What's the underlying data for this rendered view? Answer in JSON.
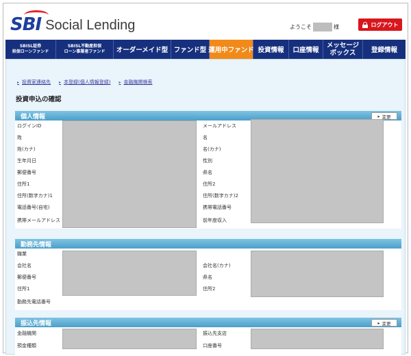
{
  "header": {
    "logo_sbi": "SBI",
    "logo_text": "Social Lending",
    "welcome_prefix": "ようこそ",
    "welcome_suffix": "様",
    "logout_label": "ログアウト"
  },
  "nav": {
    "items": [
      {
        "line1": "SBISL証券",
        "line2": "担保ローンファンド"
      },
      {
        "line1": "SBISL不動産担保",
        "line2": "ローン事業者ファンド"
      },
      {
        "label": "オーダーメイド型"
      },
      {
        "label": "ファンド型"
      },
      {
        "label": "運用中ファンド"
      },
      {
        "label": "投資情報"
      },
      {
        "label": "口座情報"
      },
      {
        "line1": "メッセージ",
        "line2": "ボックス"
      },
      {
        "label": "登録情報"
      }
    ]
  },
  "breadcrumb": [
    "投資家連絡先",
    "本登録(個人情報登録)",
    "金融機関検索"
  ],
  "page_title": "投資申込の確認",
  "edit_label": "変更",
  "sections": {
    "personal": {
      "title": "個人情報",
      "left_labels": [
        "ログインID",
        "姓",
        "姓(カナ)",
        "生年月日",
        "郵便番号",
        "住所1",
        "住所(数字カナ)1",
        "電話番号(自宅)",
        "携帯メールアドレス"
      ],
      "right_labels": [
        "メールアドレス",
        "名",
        "名(カナ)",
        "性別",
        "県名",
        "住所2",
        "住所(数字カナ)2",
        "携帯電話番号",
        "前年度収入"
      ]
    },
    "work": {
      "title": "勤務先情報",
      "left_labels": [
        "職業",
        "会社名",
        "郵便番号",
        "住所1",
        "勤務先電話番号"
      ],
      "right_labels": [
        "会社名(カナ)",
        "県名",
        "住所2"
      ]
    },
    "bank": {
      "title": "振込先情報",
      "left_labels": [
        "金融機関",
        "預金種類"
      ],
      "right_labels": [
        "振込先支店",
        "口座番号"
      ]
    }
  }
}
